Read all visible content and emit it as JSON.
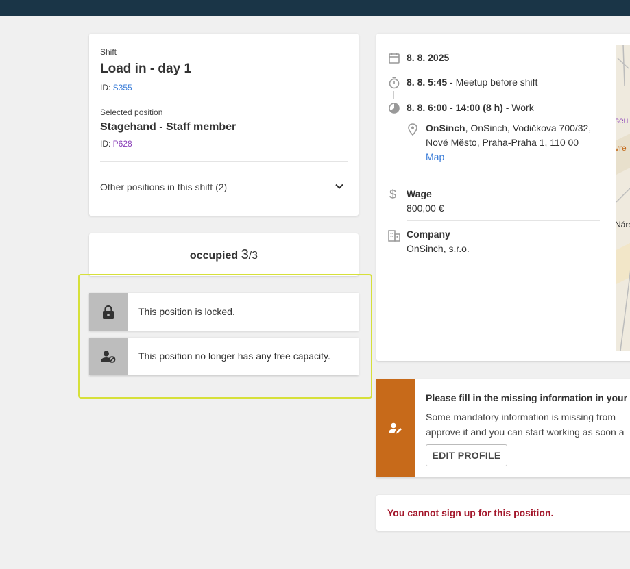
{
  "shift": {
    "label": "Shift",
    "title": "Load in - day 1",
    "id_prefix": "ID: ",
    "id_value": "S355",
    "selected_label": "Selected position",
    "position_title": "Stagehand - Staff member",
    "position_id_prefix": "ID: ",
    "position_id_value": "P628",
    "other_positions": "Other positions in this shift (2)"
  },
  "occupancy": {
    "label": "occupied",
    "current": "3",
    "total": "/3"
  },
  "notices": [
    {
      "icon": "lock-icon",
      "text": "This position is locked."
    },
    {
      "icon": "person-blocked-icon",
      "text": "This position no longer has any free capacity."
    }
  ],
  "details": {
    "date": "8. 8. 2025",
    "meetup_time": "8. 8. 5:45",
    "meetup_label": " - Meetup before shift",
    "work_time": "8. 8. 6:00 - 14:00 (8 h)",
    "work_label": " - Work",
    "location_name": "OnSinch",
    "location_line1": ", OnSinch, Vodičkova 700/32,",
    "location_line2": "Nové Město, Praha-Praha 1, 110 00",
    "map_link": "Map",
    "wage_label": "Wage",
    "wage_value": "800,00 €",
    "company_label": "Company",
    "company_value": "OnSinch, s.r.o."
  },
  "map_labels": [
    "seu",
    "vre",
    "Náro"
  ],
  "warning": {
    "title": "Please fill in the missing information in your",
    "body_line1": "Some mandatory information is missing from",
    "body_line2": "approve it and you can start working as soon a",
    "button": "EDIT PROFILE"
  },
  "cannot_sign": "You cannot sign up for this position.",
  "colors": {
    "topbar": "#1a3547",
    "warning_accent": "#c76a1a",
    "error_text": "#a3162a",
    "link": "#3b7dd8",
    "highlight": "#d6e03a"
  }
}
